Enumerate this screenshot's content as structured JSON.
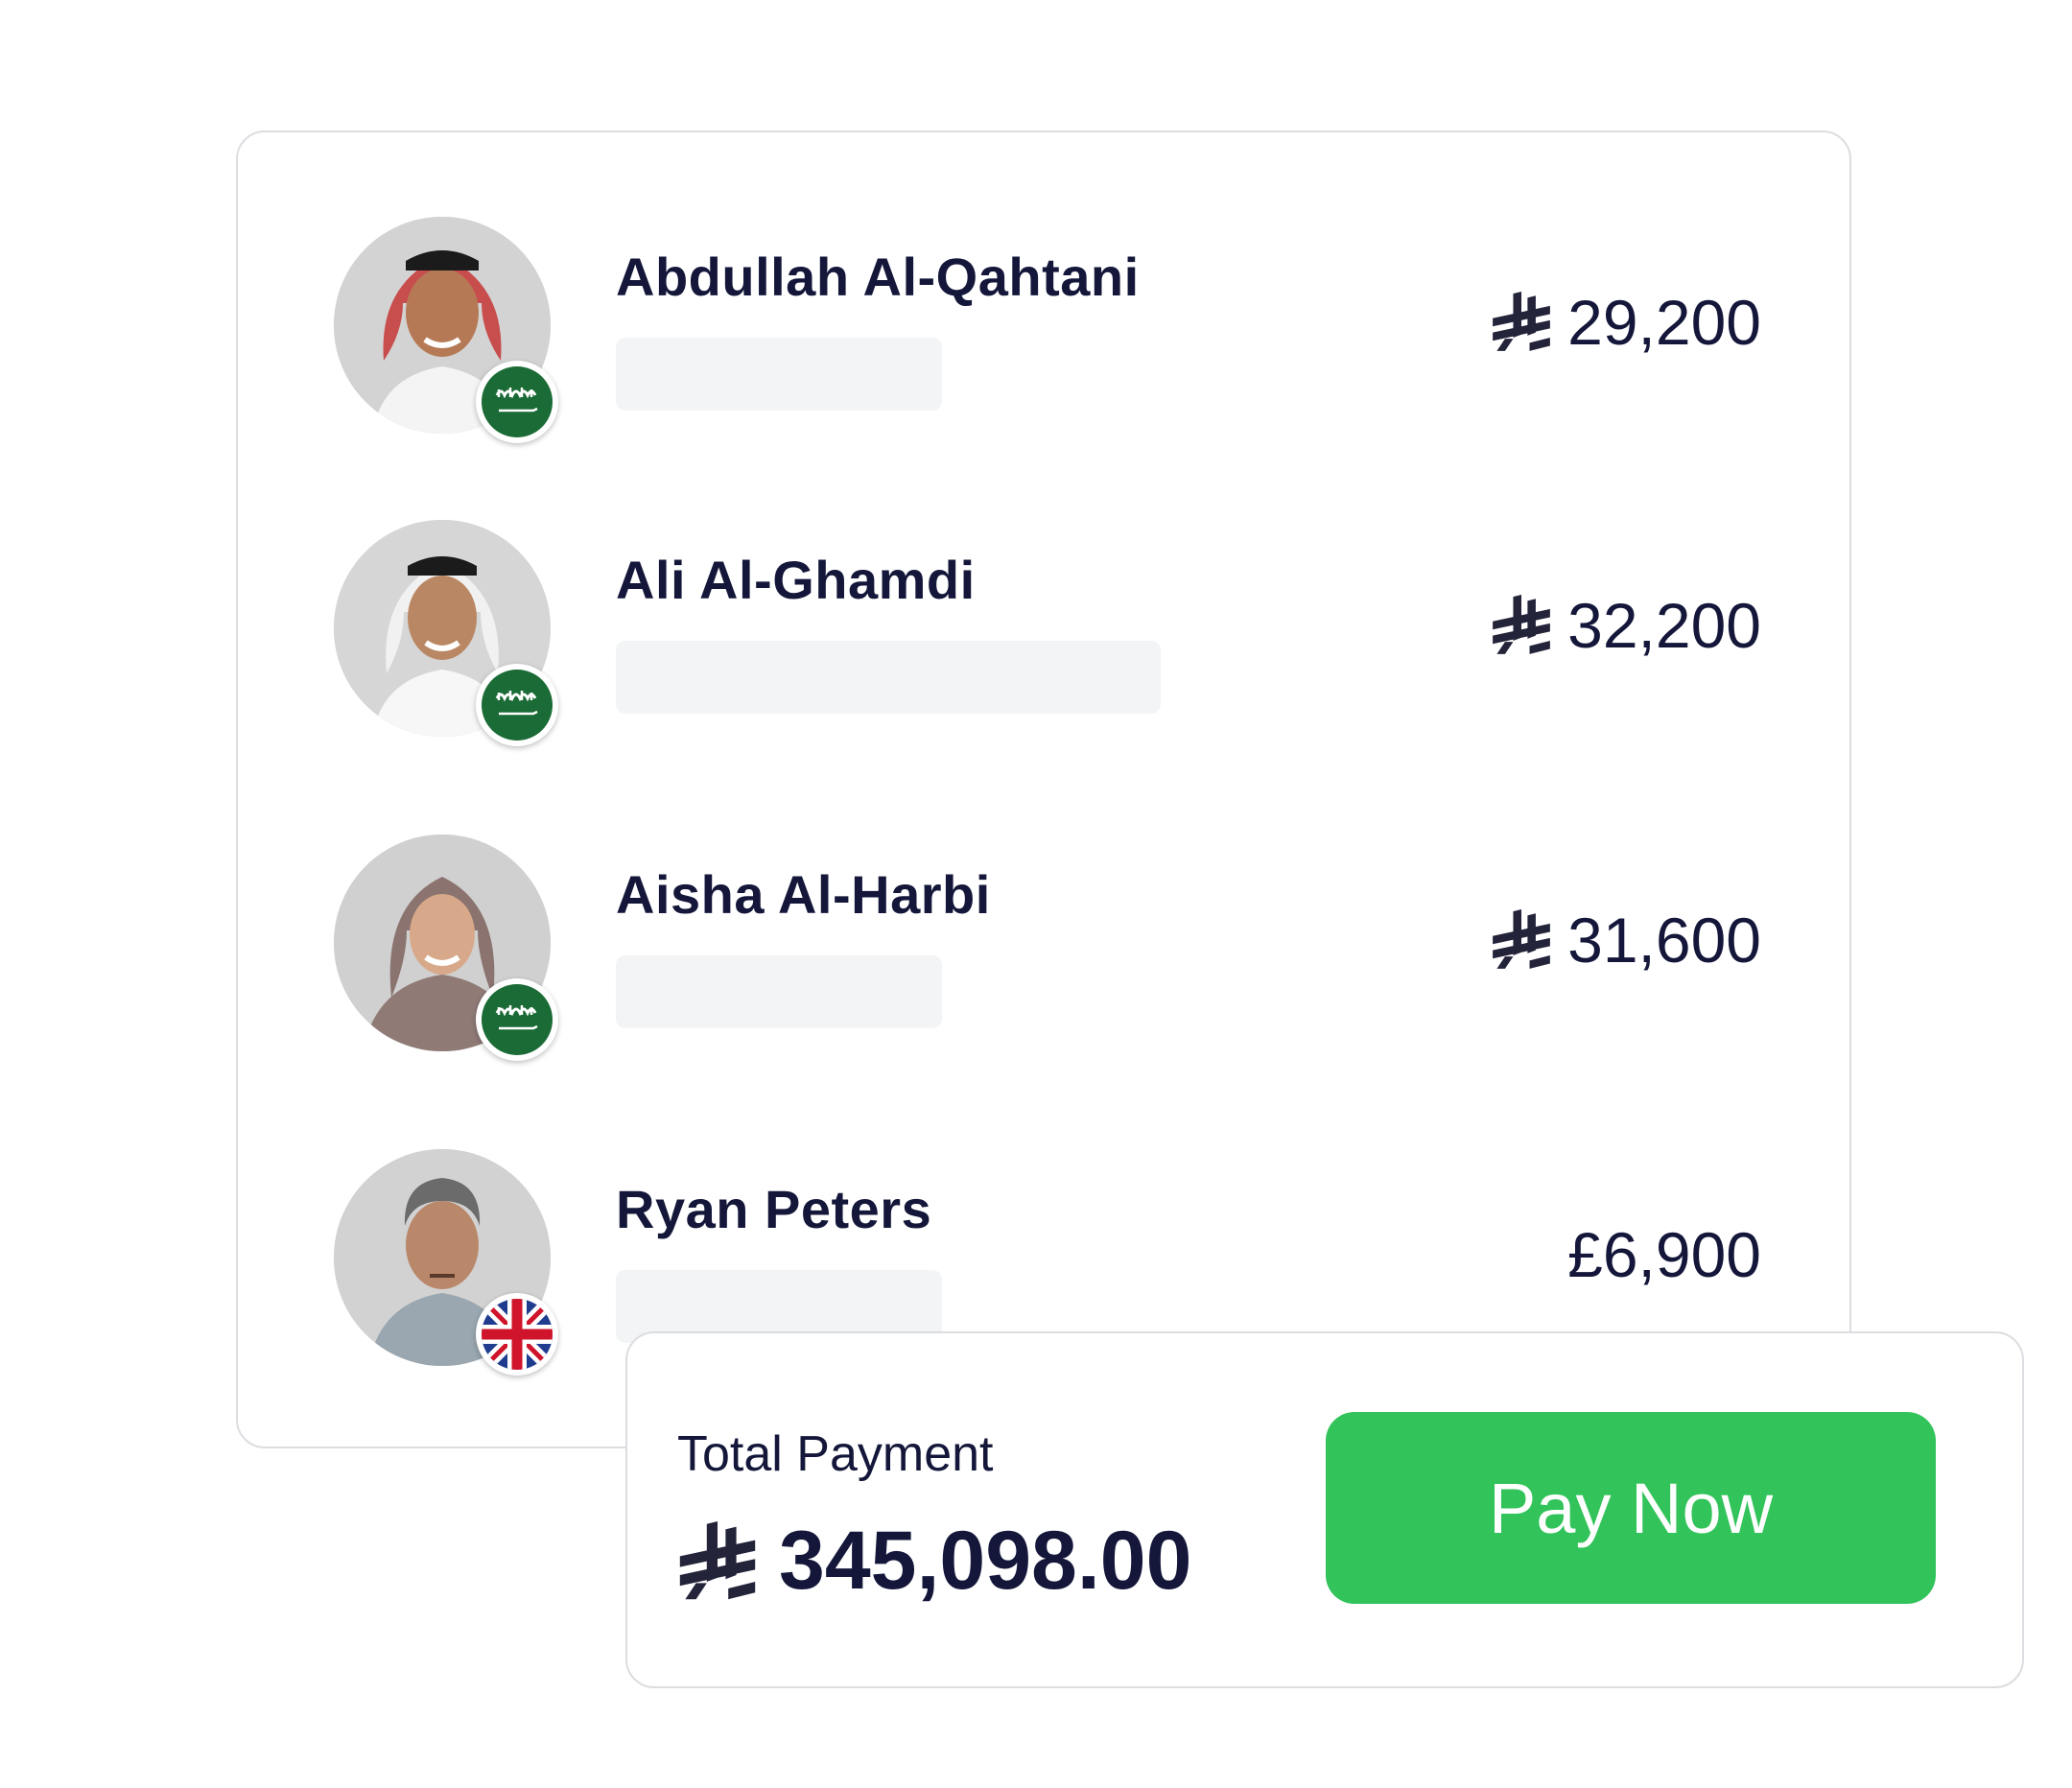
{
  "payees": [
    {
      "name": "Abdullah Al-Qahtani",
      "currency_symbol": "riyal-icon",
      "amount": "29,200",
      "flag": "saudi-arabia-flag"
    },
    {
      "name": "Ali Al-Ghamdi",
      "currency_symbol": "riyal-icon",
      "amount": "32,200",
      "flag": "saudi-arabia-flag"
    },
    {
      "name": "Aisha Al-Harbi",
      "currency_symbol": "riyal-icon",
      "amount": "31,600",
      "flag": "saudi-arabia-flag"
    },
    {
      "name": "Ryan Peters",
      "currency_symbol": "",
      "amount": "£6,900",
      "flag": "uk-flag"
    }
  ],
  "summary": {
    "total_label": "Total Payment",
    "total_value": "345,098.00",
    "currency_symbol": "riyal-icon",
    "pay_button_label": "Pay Now"
  },
  "colors": {
    "text": "#14173a",
    "pay_button": "#32c35a",
    "saudi_green": "#1a6b35",
    "border": "#dcdde1",
    "placeholder": "#f3f4f5"
  }
}
